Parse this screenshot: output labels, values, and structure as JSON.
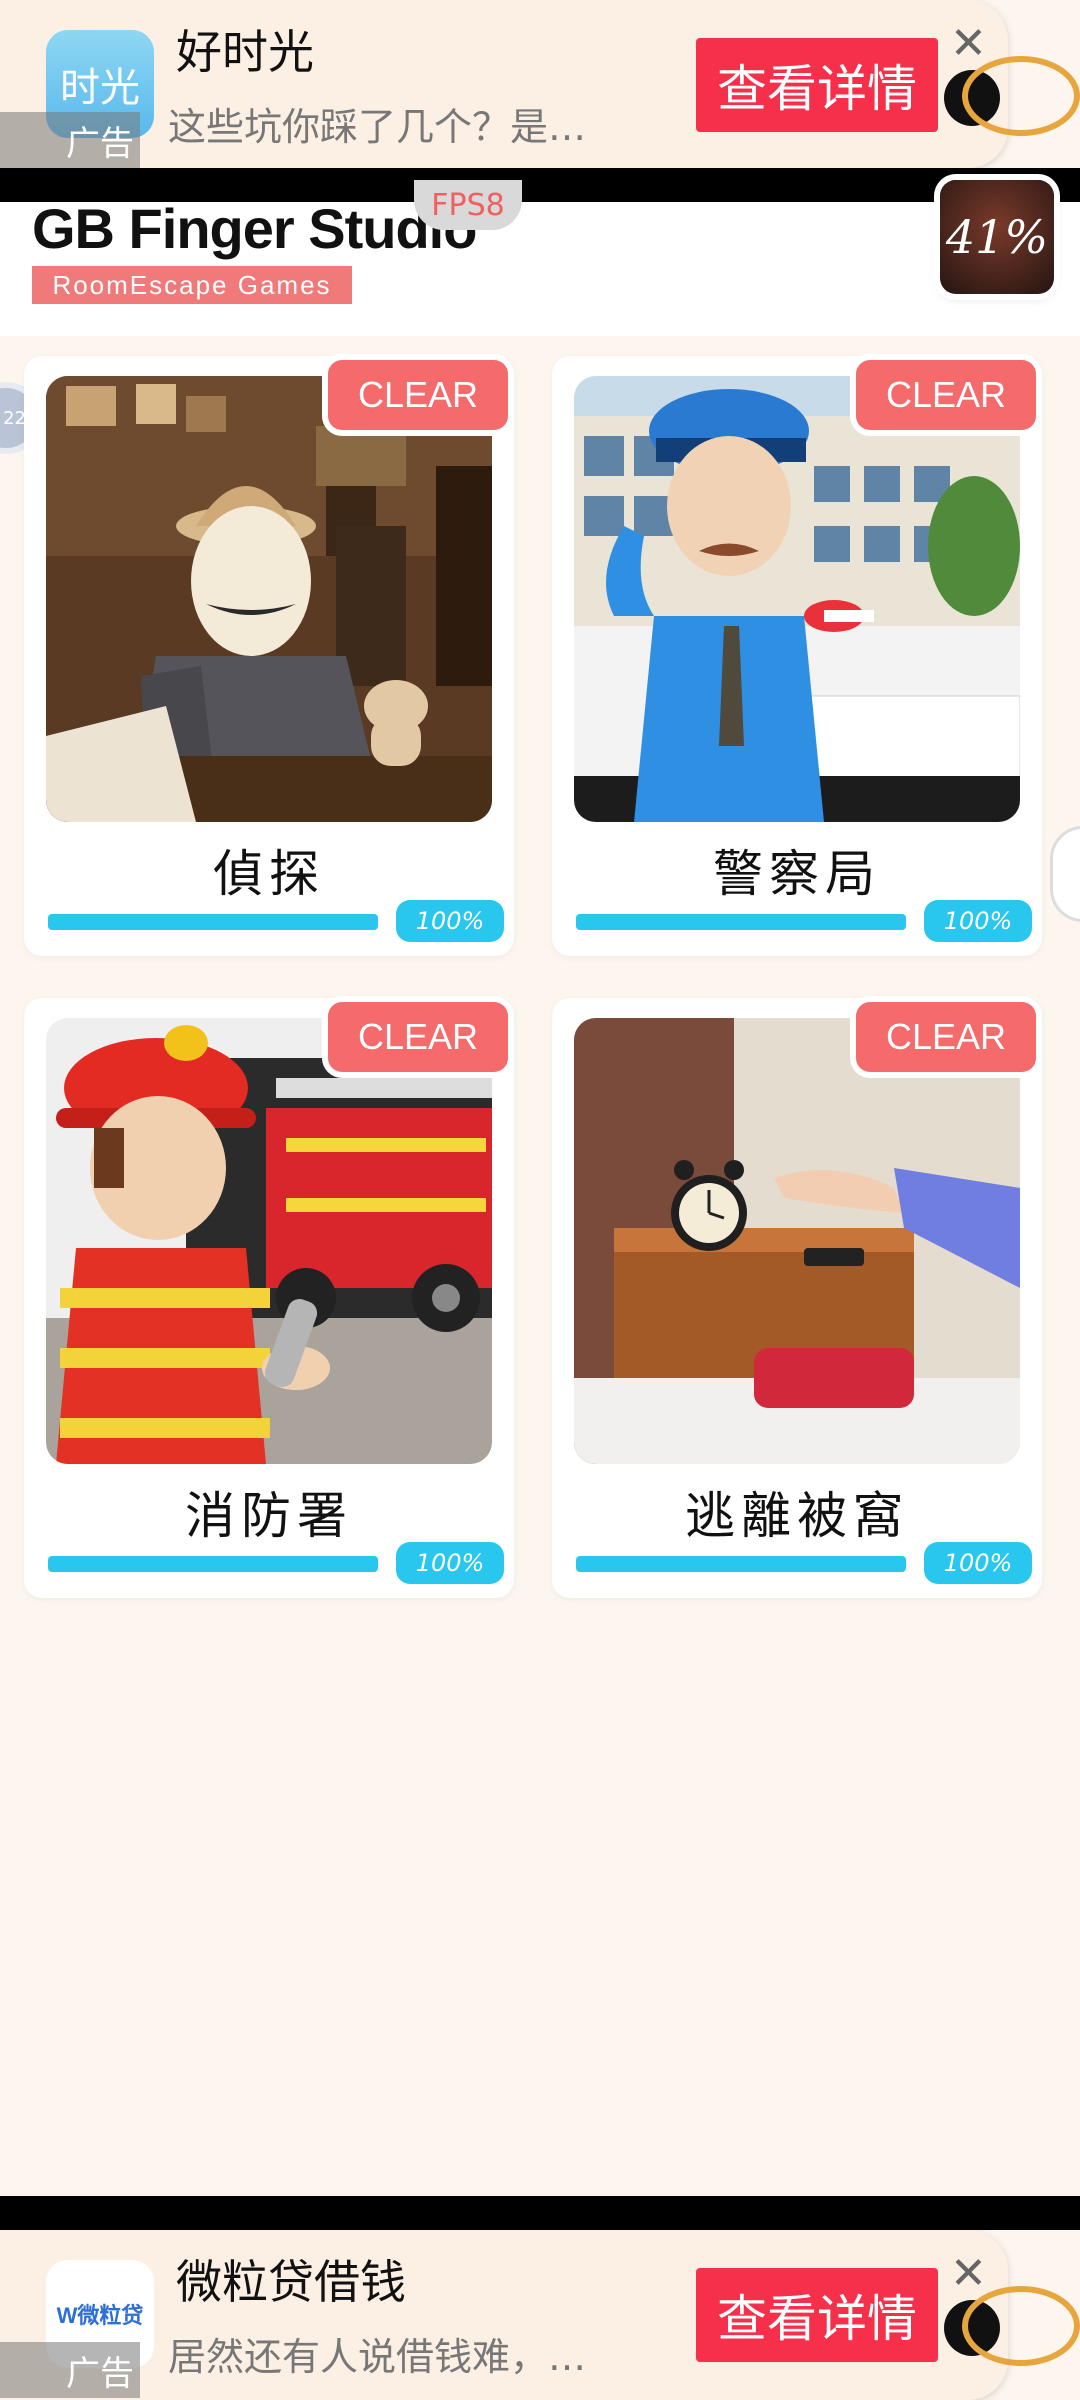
{
  "top_ad": {
    "icon_text": "时光",
    "title": "好时光",
    "subtitle": "这些坑你踩了几个？是…",
    "button_label": "查看详情",
    "tag": "广告",
    "close": "✕"
  },
  "header": {
    "title": "GB Finger Studio",
    "subtitle": "RoomEscape  Games",
    "fps": "FPS8",
    "progress": "41%"
  },
  "edge_bubble": "22",
  "cards": [
    {
      "title": "偵探",
      "badge": "CLEAR",
      "progress": "100%",
      "progress_value": 1.0
    },
    {
      "title": "警察局",
      "badge": "CLEAR",
      "progress": "100%",
      "progress_value": 1.0
    },
    {
      "title": "消防署",
      "badge": "CLEAR",
      "progress": "100%",
      "progress_value": 1.0
    },
    {
      "title": "逃離被窩",
      "badge": "CLEAR",
      "progress": "100%",
      "progress_value": 1.0
    }
  ],
  "bottom_ad": {
    "icon_text": "W微粒贷",
    "title": "微粒贷借钱",
    "subtitle": "居然还有人说借钱难，…",
    "button_label": "查看详情",
    "tag": "广告",
    "close": "✕"
  },
  "colors": {
    "accent_cyan": "#29c7ee",
    "clear_red": "#f56a6a",
    "ad_button": "#f6304a"
  }
}
